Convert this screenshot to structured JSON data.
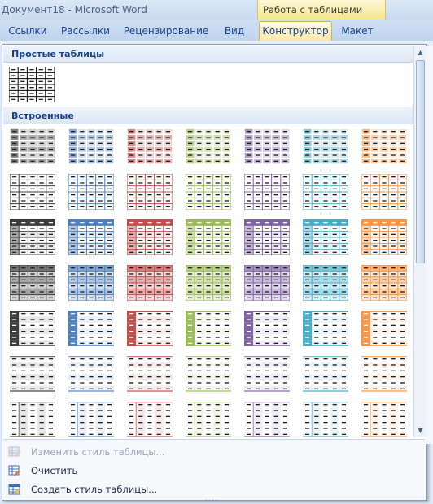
{
  "window": {
    "title": "Документ18 - Microsoft Word"
  },
  "context_tab_group": {
    "label": "Работа с таблицами"
  },
  "tabs": [
    {
      "label": "Ссылки",
      "active": false
    },
    {
      "label": "Рассылки",
      "active": false
    },
    {
      "label": "Рецензирование",
      "active": false
    },
    {
      "label": "Вид",
      "active": false
    },
    {
      "label": "Конструктор",
      "active": true
    },
    {
      "label": "Макет",
      "active": false
    }
  ],
  "gallery": {
    "sections": [
      {
        "title": "Простые таблицы"
      },
      {
        "title": "Встроенные"
      }
    ],
    "simple_style": {
      "name": "table-grid-style"
    },
    "color_columns": [
      "#3c3c3c",
      "#4f81bd",
      "#c0504d",
      "#9bbb59",
      "#8064a2",
      "#4bacc6",
      "#f79646"
    ],
    "style_rows": [
      {
        "variant": "shaded"
      },
      {
        "variant": "grid-outline"
      },
      {
        "variant": "grid-header"
      },
      {
        "variant": "banded-fill"
      },
      {
        "variant": "first-column-dark"
      },
      {
        "variant": "banded-light"
      },
      {
        "variant": "center-column"
      }
    ]
  },
  "menu": {
    "items": [
      {
        "label": "Изменить стиль таблицы...",
        "enabled": false,
        "icon": "modify-table-style-icon"
      },
      {
        "label": "Очистить",
        "enabled": true,
        "icon": "clear-table-style-icon"
      },
      {
        "label": "Создать стиль таблицы...",
        "enabled": true,
        "icon": "new-table-style-icon"
      }
    ]
  }
}
